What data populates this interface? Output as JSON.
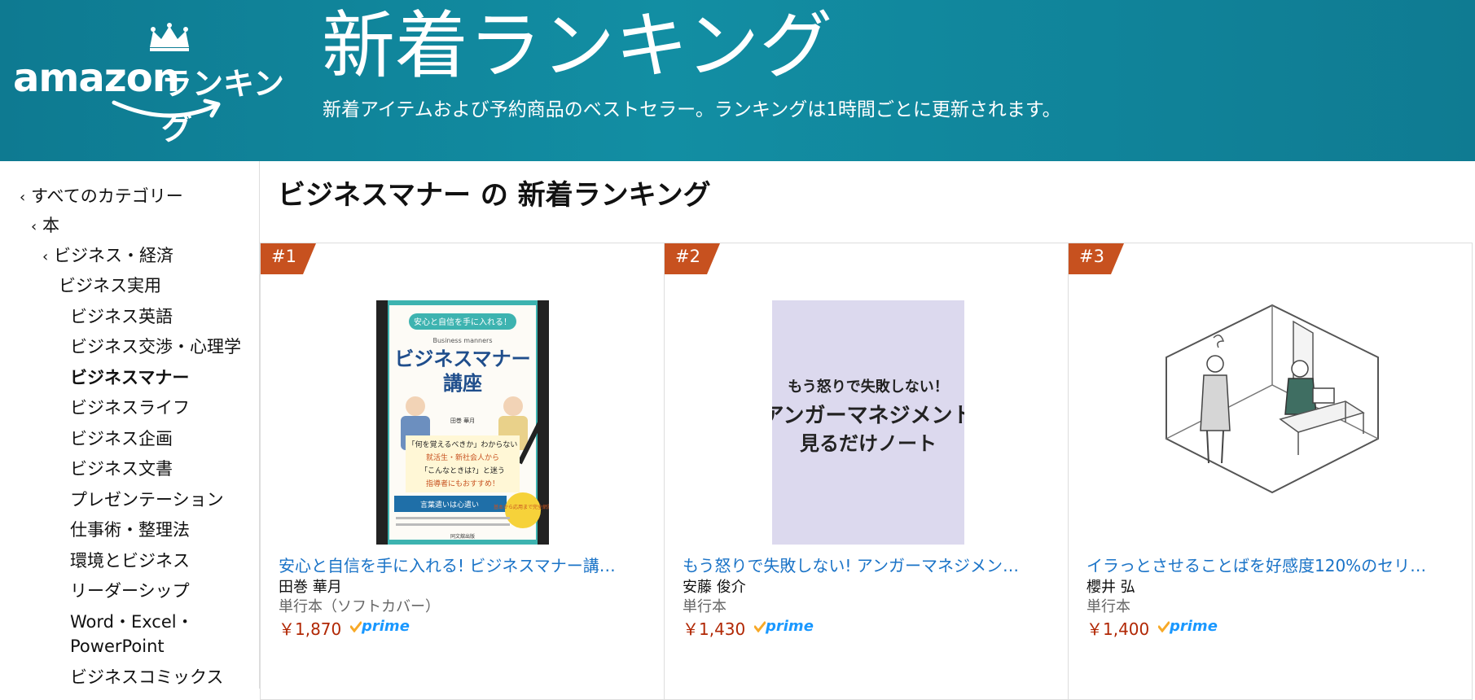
{
  "header": {
    "logo_brand": "amazon",
    "logo_ranking": "ランキング",
    "title": "新着ランキング",
    "subtitle": "新着アイテムおよび予約商品のベストセラー。ランキングは1時間ごとに更新されます。",
    "colors": {
      "bg": "#0e7a91",
      "text": "#ffffff"
    }
  },
  "sidebar": {
    "items": [
      {
        "label": "すべてのカテゴリー",
        "chevron": "‹"
      },
      {
        "label": "本",
        "chevron": "‹"
      },
      {
        "label": "ビジネス・経済",
        "chevron": "‹"
      },
      {
        "label": "ビジネス実用"
      },
      {
        "label": "ビジネス英語"
      },
      {
        "label": "ビジネス交渉・心理学"
      },
      {
        "label": "ビジネスマナー",
        "selected": true
      },
      {
        "label": "ビジネスライフ"
      },
      {
        "label": "ビジネス企画"
      },
      {
        "label": "ビジネス文書"
      },
      {
        "label": "プレゼンテーション"
      },
      {
        "label": "仕事術・整理法"
      },
      {
        "label": "環境とビジネス"
      },
      {
        "label": "リーダーシップ"
      },
      {
        "label": "Word・Excel・"
      },
      {
        "label": "PowerPoint"
      },
      {
        "label": "ビジネスコミックス"
      }
    ]
  },
  "main": {
    "title": "ビジネスマナー の 新着ランキング",
    "products": [
      {
        "rank": "#1",
        "title": "安心と自信を手に入れる! ビジネスマナー講…",
        "author": "田巻 華月",
        "format": "単行本（ソフトカバー）",
        "price": "￥1,870",
        "prime": "prime",
        "cover": {
          "banner": "安心と自信を手に入れる！",
          "eyebrow": "Business manners",
          "title1": "ビジネスマナー",
          "title2": "講座",
          "author_small": "田巻 華月",
          "quote1": "「何を覚えるべきか」わからない",
          "quote2": "就活生・新社会人から",
          "quote3": "「こんなときは?」と迷う",
          "quote4": "指導者にもおすすめ！",
          "note": "言葉遣いは心遣い",
          "badge": "基本から応用まで完全網羅",
          "publisher": "同文舘出版"
        }
      },
      {
        "rank": "#2",
        "title": "もう怒りで失敗しない! アンガーマネジメン…",
        "author": "安藤 俊介",
        "format": "単行本",
        "price": "￥1,430",
        "prime": "prime",
        "cover": {
          "line1": "もう怒りで失敗しない！",
          "line2": "アンガーマネジメント",
          "line3": "見るだけノート"
        }
      },
      {
        "rank": "#3",
        "title": "イラっとさせることばを好感度120%のセリ…",
        "author": "櫻井 弘",
        "format": "単行本",
        "price": "￥1,400",
        "prime": "prime"
      }
    ]
  },
  "colors": {
    "badge": "#c7511f",
    "link": "#1a73c7",
    "price": "#b12704",
    "prime": "#1a98ff",
    "check": "#f7a928"
  }
}
